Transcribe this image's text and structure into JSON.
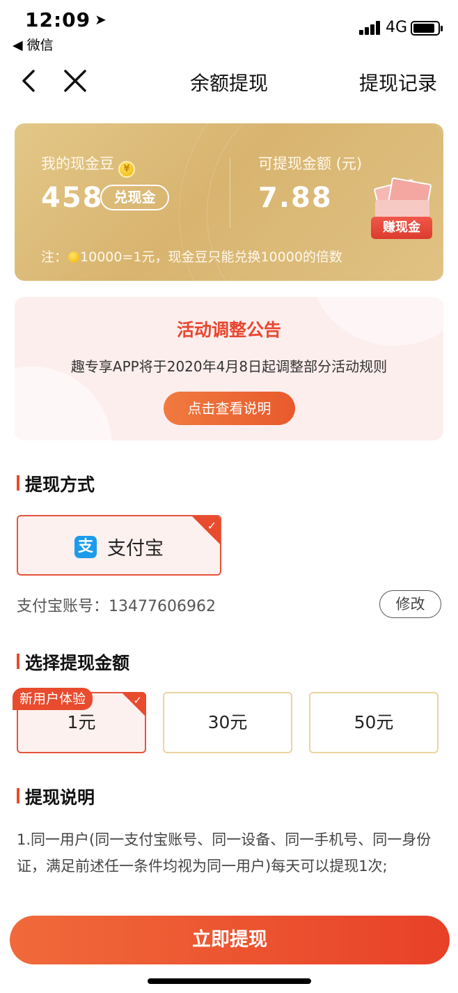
{
  "status_bar": {
    "time": "12:09",
    "back_app": "◀ 微信",
    "network": "4G"
  },
  "nav": {
    "title": "余额提现",
    "record": "提现记录"
  },
  "balance": {
    "beans_label": "我的现金豆",
    "beans_value": "458",
    "exchange_label": "兑现金",
    "withdrawable_label": "可提现金额 (元)",
    "withdrawable_value": "7.88",
    "earn_label": "赚现金",
    "note_prefix": "注：",
    "note_text": "10000=1元，现金豆只能兑换10000的倍数"
  },
  "notice": {
    "title": "活动调整公告",
    "text": "趣专享APP将于2020年4月8日起调整部分活动规则",
    "button": "点击查看说明"
  },
  "method": {
    "section_title": "提现方式",
    "option": "支付宝",
    "account_label": "支付宝账号：13477606962",
    "modify": "修改"
  },
  "amounts": {
    "section_title": "选择提现金额",
    "options": [
      {
        "label": "1元",
        "tag": "新用户体验",
        "selected": true
      },
      {
        "label": "30元",
        "selected": false
      },
      {
        "label": "50元",
        "selected": false
      }
    ]
  },
  "description": {
    "section_title": "提现说明",
    "text": "1.同一用户(同一支付宝账号、同一设备、同一手机号、同一身份证，满足前述任一条件均视为同一用户)每天可以提现1次;"
  },
  "submit": {
    "label": "立即提现"
  },
  "colors": {
    "accent": "#e84b2d",
    "gold": "#dcb977",
    "alipay": "#1c9bed"
  }
}
